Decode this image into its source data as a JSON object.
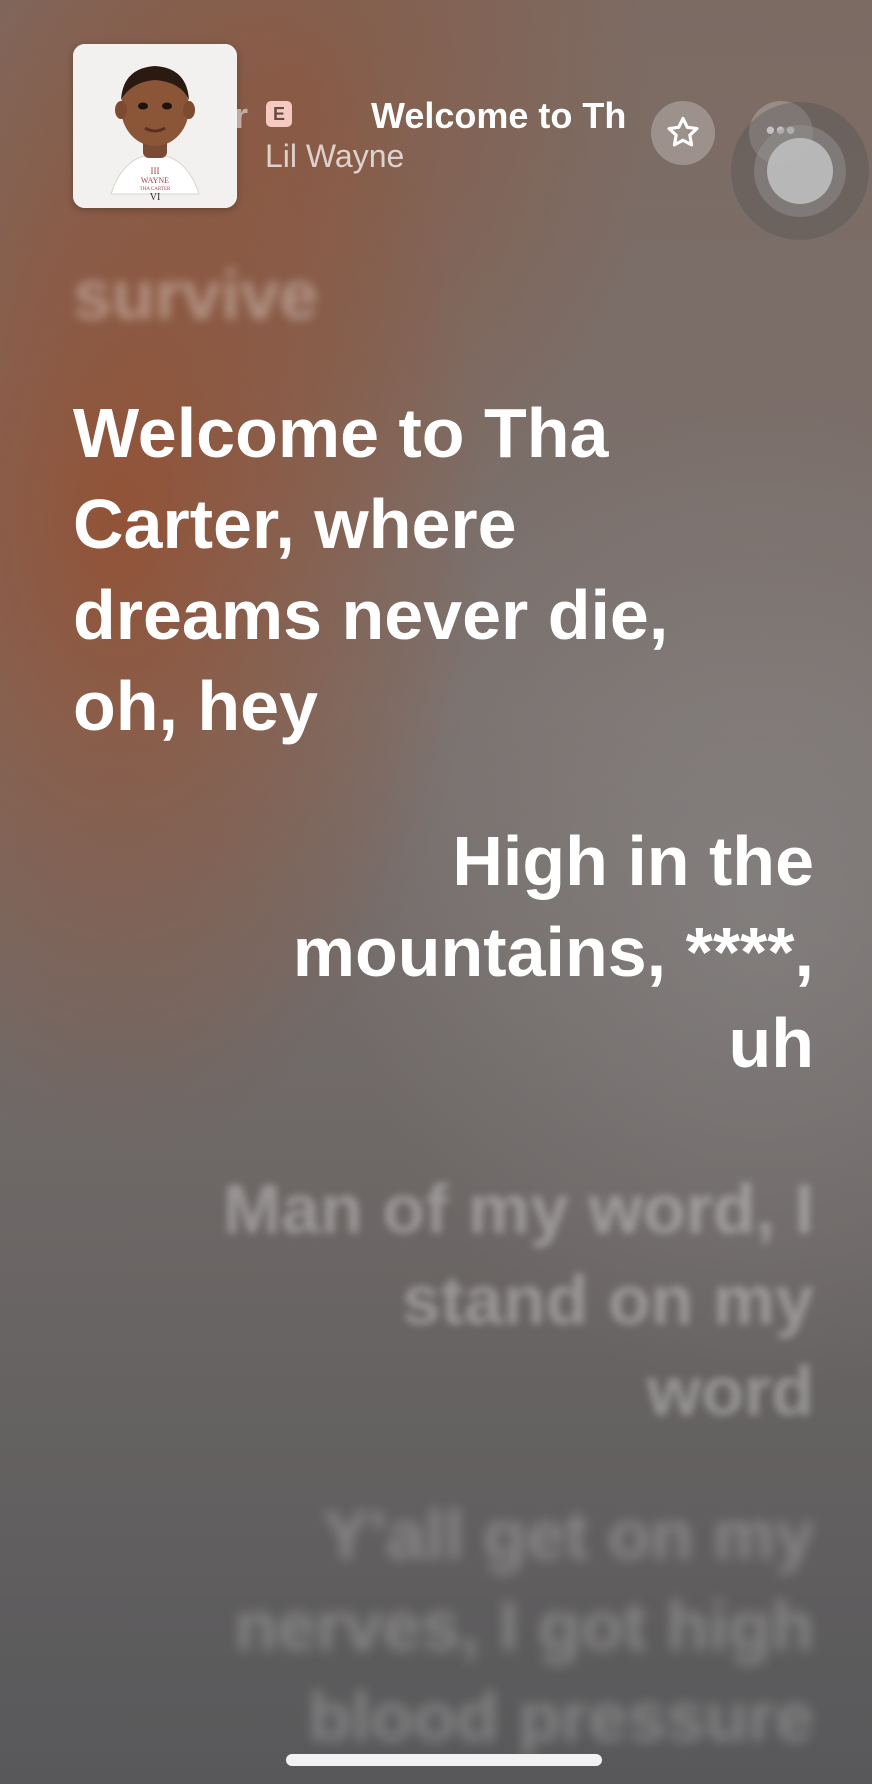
{
  "now_playing": {
    "title_fragment": "r",
    "explicit_badge": "E",
    "title": "Welcome to Th",
    "artist": "Lil Wayne",
    "artwork": {
      "text_line1": "III",
      "text_line2": "WAYNE",
      "text_line3": "THA CARTER",
      "text_line4": "VI"
    }
  },
  "controls": {
    "favorite_icon": "star-icon",
    "more_label": "•••"
  },
  "lyrics": {
    "previous": "survive",
    "current": [
      "Welcome to Tha",
      "Carter, where",
      "dreams never die,",
      "oh, hey"
    ],
    "next": [
      "High in the",
      "mountains, ****,",
      "uh"
    ],
    "upcoming_1": [
      "Man of my word, I",
      "stand on my",
      "word"
    ],
    "upcoming_2": [
      "Y'all get on my",
      "nerves, I got high",
      "blood pressure"
    ]
  },
  "colors": {
    "accent_warm": "#964e2e",
    "background_gray": "#6e6a68",
    "explicit_badge_bg": "#f6c9c1"
  }
}
